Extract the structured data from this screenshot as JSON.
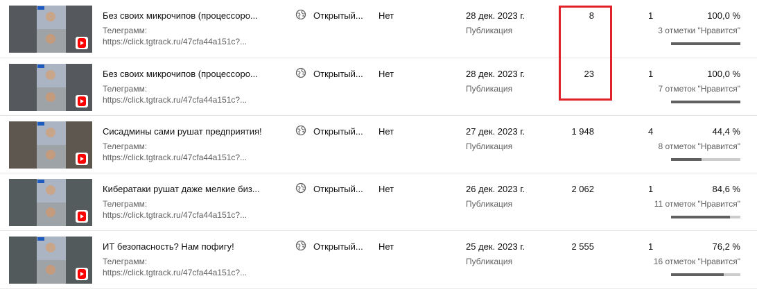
{
  "rows": [
    {
      "title": "Без своих микрочипов (процессоро...",
      "desc_line1": "Телеграмм:",
      "desc_line2": "https://click.tgtrack.ru/47cfa44a151c?...",
      "visibility": "Открытый...",
      "restrictions": "Нет",
      "date": "28 дек. 2023 г.",
      "date_type": "Публикация",
      "views": "8",
      "comments": "1",
      "like_percent": "100,0 %",
      "likes": "3 отметки \"Нравится\"",
      "like_ratio": 1.0
    },
    {
      "title": "Без своих микрочипов (процессоро...",
      "desc_line1": "Телеграмм:",
      "desc_line2": "https://click.tgtrack.ru/47cfa44a151c?...",
      "visibility": "Открытый...",
      "restrictions": "Нет",
      "date": "28 дек. 2023 г.",
      "date_type": "Публикация",
      "views": "23",
      "comments": "1",
      "like_percent": "100,0 %",
      "likes": "7 отметок \"Нравится\"",
      "like_ratio": 1.0
    },
    {
      "title": "Сисадмины сами рушат предприятия!",
      "desc_line1": "Телеграмм:",
      "desc_line2": "https://click.tgtrack.ru/47cfa44a151c?...",
      "visibility": "Открытый...",
      "restrictions": "Нет",
      "date": "27 дек. 2023 г.",
      "date_type": "Публикация",
      "views": "1 948",
      "comments": "4",
      "like_percent": "44,4 %",
      "likes": "8 отметок \"Нравится\"",
      "like_ratio": 0.444
    },
    {
      "title": "Кибератаки рушат даже мелкие биз...",
      "desc_line1": "Телеграмм:",
      "desc_line2": "https://click.tgtrack.ru/47cfa44a151c?...",
      "visibility": "Открытый...",
      "restrictions": "Нет",
      "date": "26 дек. 2023 г.",
      "date_type": "Публикация",
      "views": "2 062",
      "comments": "1",
      "like_percent": "84,6 %",
      "likes": "11 отметок \"Нравится\"",
      "like_ratio": 0.846
    },
    {
      "title": "ИТ безопасность? Нам пофигу!",
      "desc_line1": "Телеграмм:",
      "desc_line2": "https://click.tgtrack.ru/47cfa44a151c?...",
      "visibility": "Открытый...",
      "restrictions": "Нет",
      "date": "25 дек. 2023 г.",
      "date_type": "Публикация",
      "views": "2 555",
      "comments": "1",
      "like_percent": "76,2 %",
      "likes": "16 отметок \"Нравится\"",
      "like_ratio": 0.762
    }
  ],
  "colors": {
    "highlight_border": "#e0212b",
    "secondary_text": "#606060",
    "shorts_badge": "#ff0000"
  }
}
